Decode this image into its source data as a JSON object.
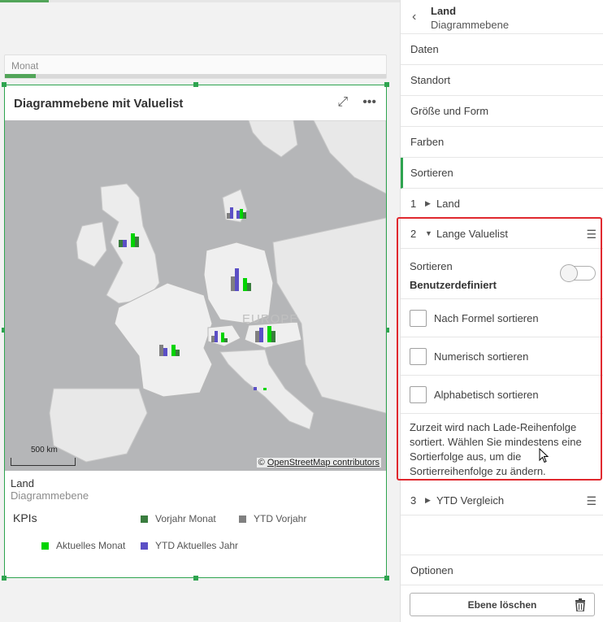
{
  "filter": {
    "label": "Monat",
    "progress_percent": 8
  },
  "card": {
    "title": "Diagrammebene mit Valuelist",
    "expand_icon": "expand-icon",
    "more_icon": "more-icon"
  },
  "map": {
    "region_label": "EUROPE",
    "scale_label": "500 km",
    "attribution_prefix": "©",
    "attribution_link": "OpenStreetMap contributors"
  },
  "legend": {
    "title": "Land",
    "subtitle": "Diagrammebene",
    "kpi_label": "KPIs",
    "items": [
      {
        "label": "Vorjahr Monat",
        "color": "#3a7d3e"
      },
      {
        "label": "YTD Vorjahr",
        "color": "#808080"
      },
      {
        "label": "Aktuelles Monat",
        "color": "#00d400"
      },
      {
        "label": "YTD Aktuelles Jahr",
        "color": "#5b4fc6"
      }
    ]
  },
  "panel": {
    "title": "Land",
    "subtitle": "Diagrammebene",
    "sections": [
      "Daten",
      "Standort",
      "Größe und Form",
      "Farben",
      "Sortieren"
    ],
    "sort_items": [
      {
        "num": "1",
        "label": "Land"
      },
      {
        "num": "2",
        "label": "Lange Valuelist"
      },
      {
        "num": "3",
        "label": "YTD Vergleich"
      }
    ],
    "sort_label": "Sortieren",
    "sort_mode": "Benutzerdefiniert",
    "options": [
      "Nach Formel sortieren",
      "Numerisch sortieren",
      "Alphabetisch sortieren"
    ],
    "info": "Zurzeit wird nach Lade-Reihenfolge sortiert. Wählen Sie mindestens eine Sortierfolge aus, um die Sortierreihenfolge zu ändern.",
    "options_section": "Optionen",
    "delete_label": "Ebene löschen"
  },
  "colors": {
    "accent": "#2ea44f",
    "highlight": "#e0282e"
  }
}
